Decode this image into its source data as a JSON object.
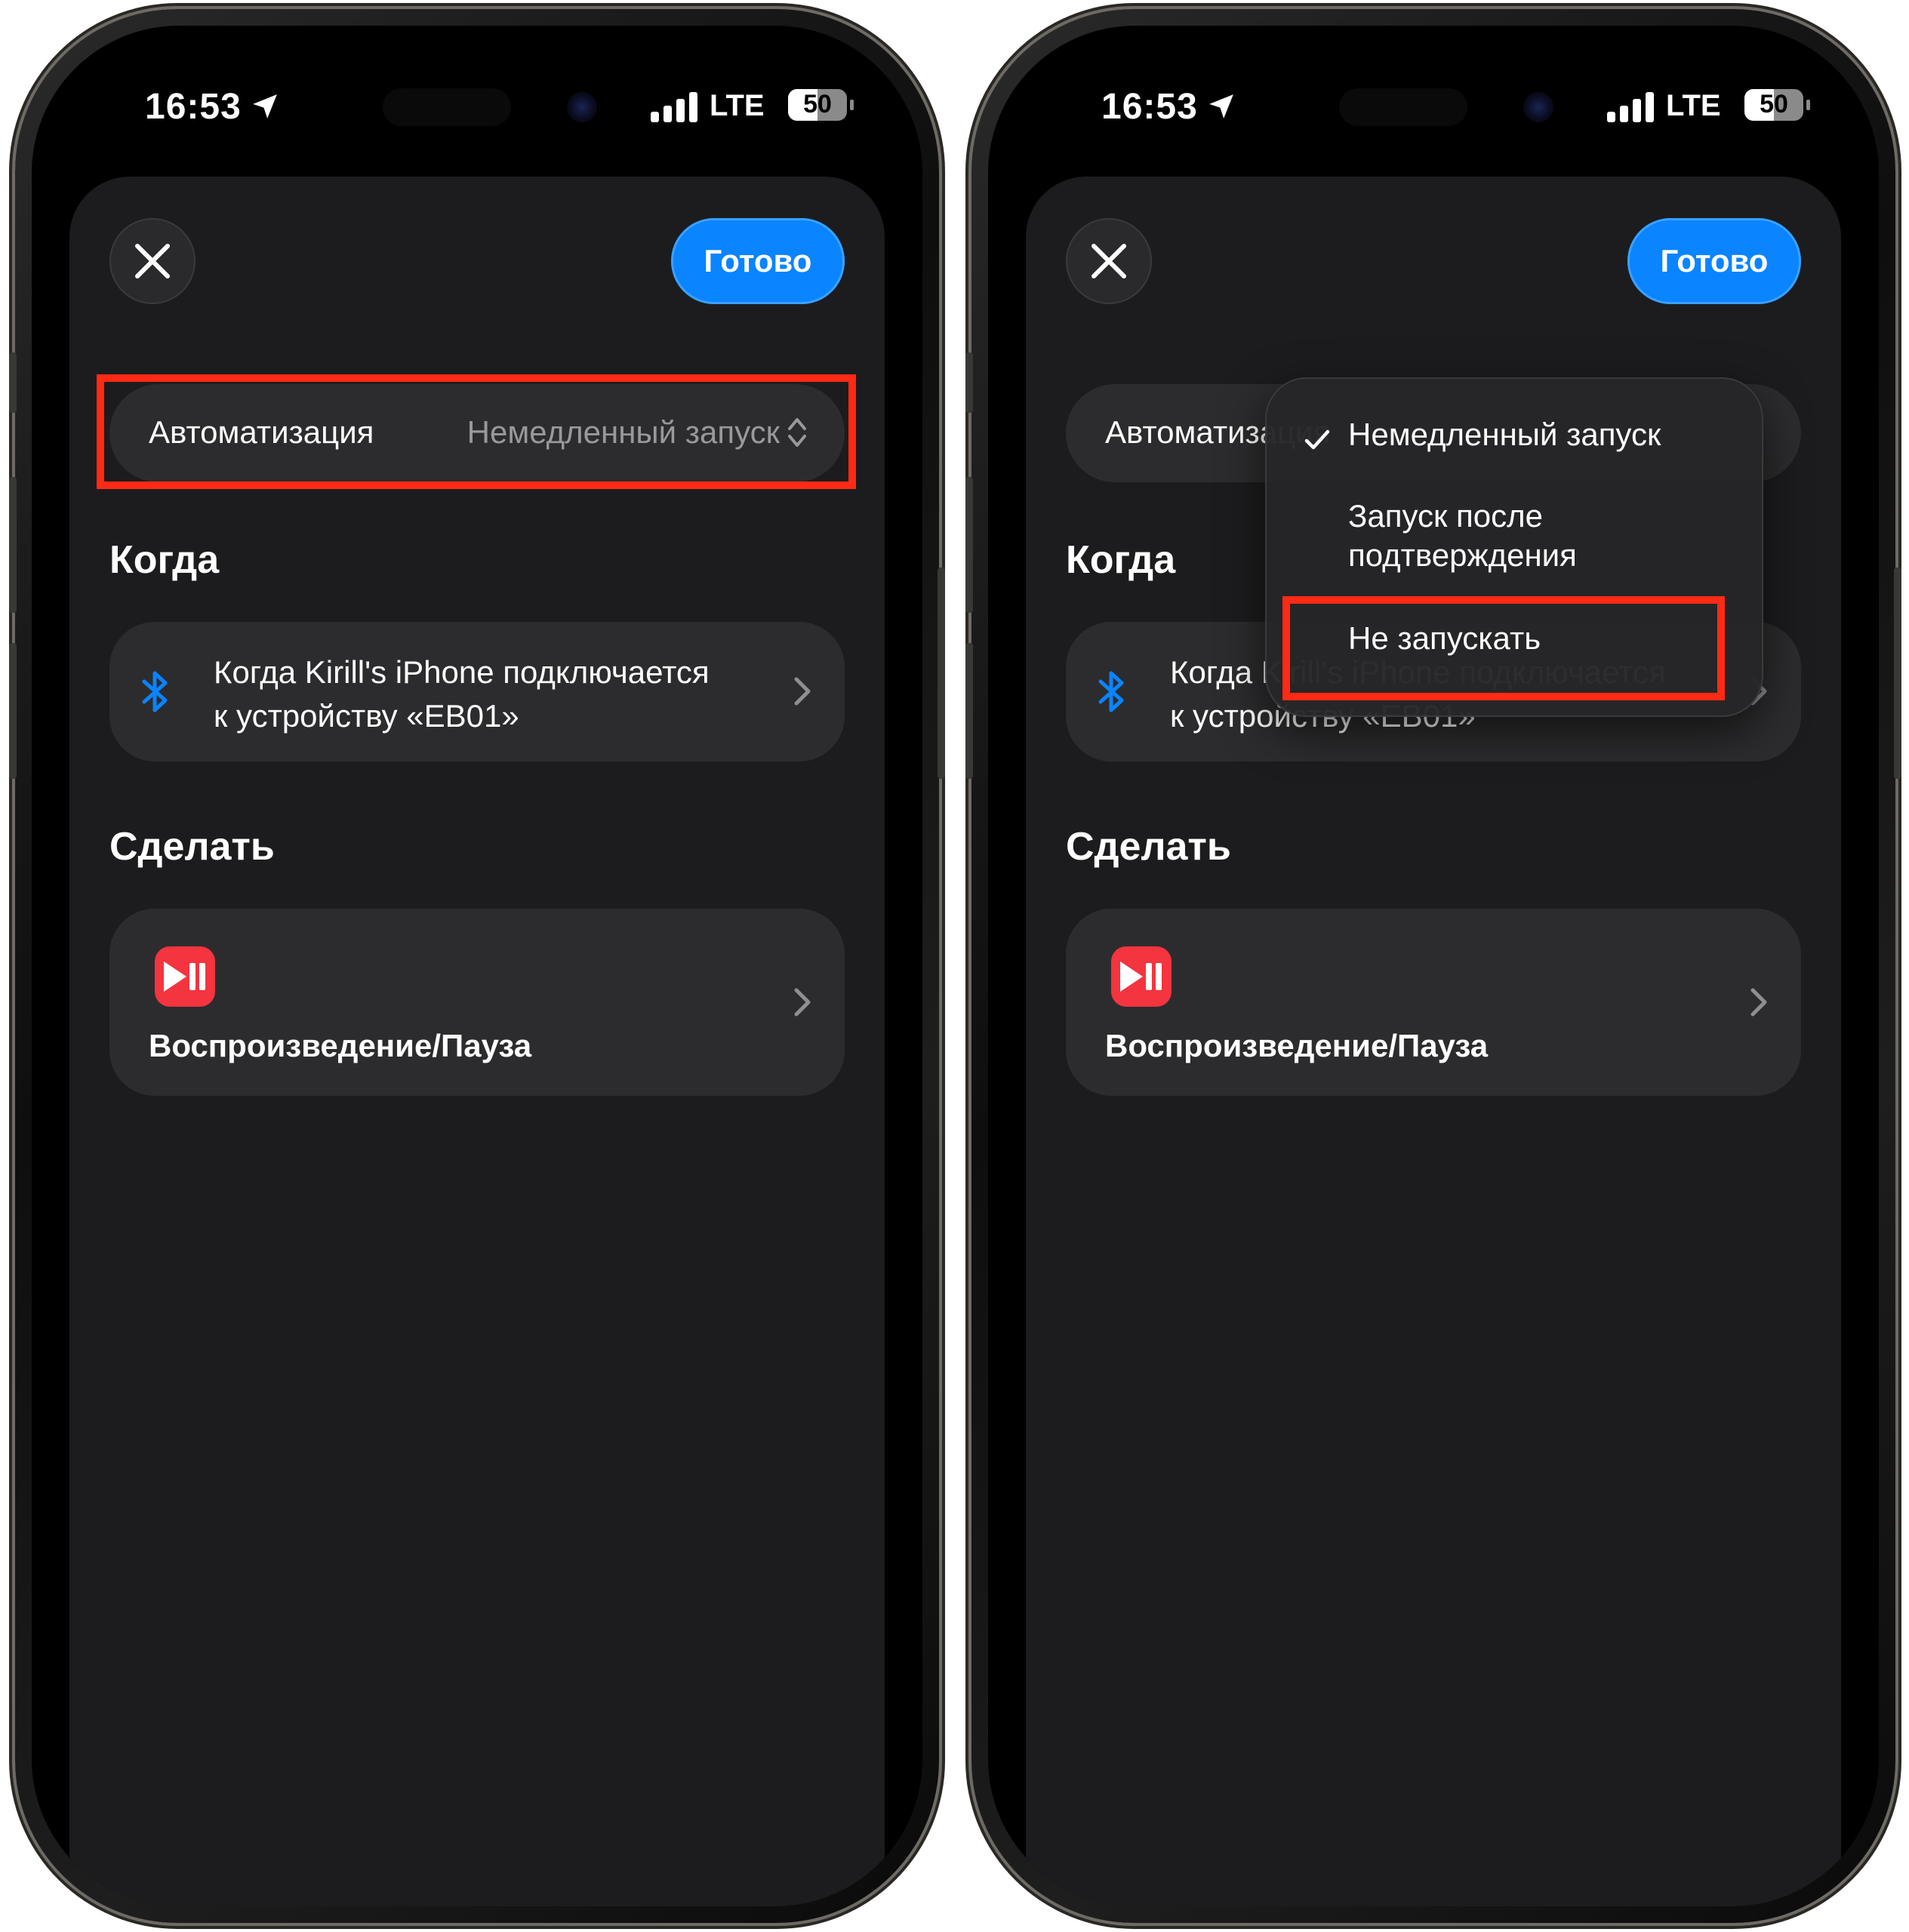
{
  "status_bar": {
    "time": "16:53",
    "network": "LTE",
    "battery": "50",
    "battery_level": 0.5
  },
  "header": {
    "done_label": "Готово"
  },
  "automation_row": {
    "label": "Автоматизация",
    "value": "Немедленный запуск"
  },
  "when_section": {
    "title": "Когда",
    "trigger_text": "Когда Kirill's iPhone подключается к устройству «EB01»"
  },
  "do_section": {
    "title": "Сделать",
    "action_label": "Воспроизведение/Пауза"
  },
  "run_menu": {
    "items": [
      {
        "label": "Немедленный запуск",
        "checked": true
      },
      {
        "label": "Запуск после подтверждения",
        "checked": false
      },
      {
        "label": "Не запускать",
        "checked": false
      }
    ]
  },
  "colors": {
    "accent": "#0a84ff",
    "highlight": "#ff2a14",
    "action_icon": "#f4343f",
    "sheet": "#1c1c1e",
    "row": "#2c2c2e"
  },
  "icons": [
    "close-icon",
    "location-arrow-icon",
    "signal-icon",
    "battery-icon",
    "updown-chevron-icon",
    "bluetooth-icon",
    "chevron-right-icon",
    "play-pause-icon",
    "checkmark-icon"
  ]
}
